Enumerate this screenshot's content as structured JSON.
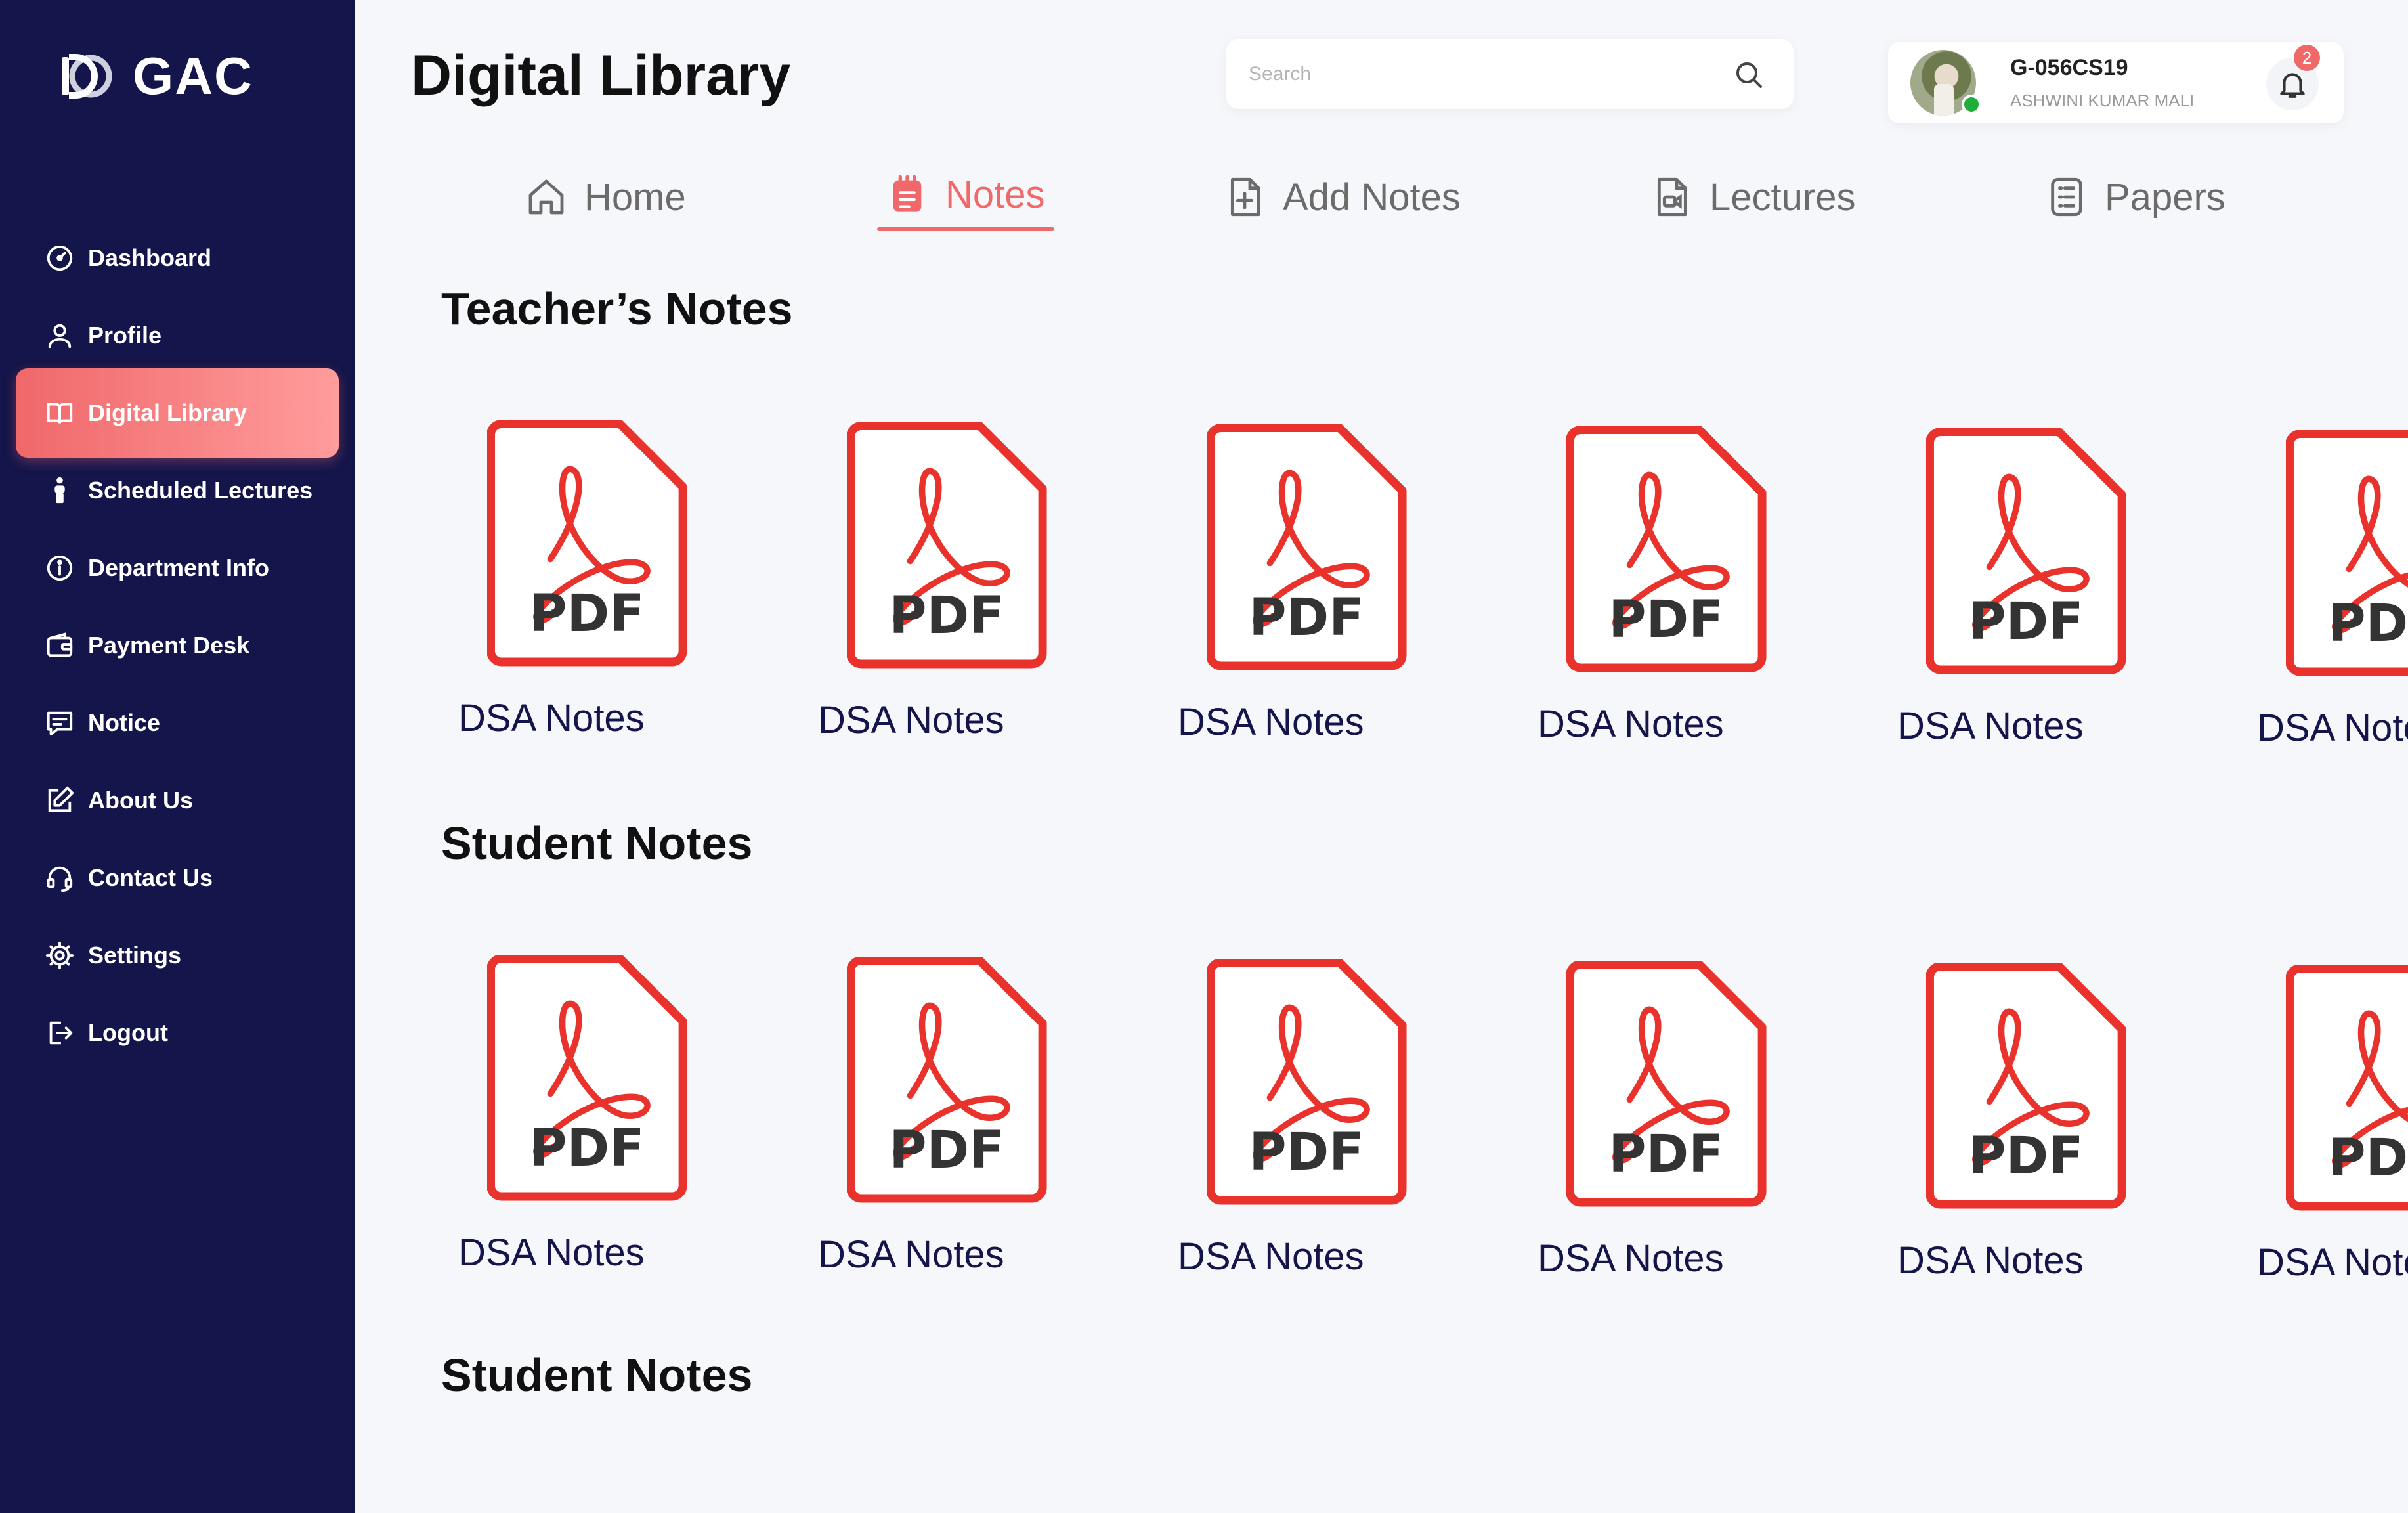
{
  "brand": {
    "name": "GAC"
  },
  "sidebar": {
    "items": [
      {
        "label": "Dashboard",
        "icon": "gauge-icon",
        "active": false
      },
      {
        "label": "Profile",
        "icon": "user-icon",
        "active": false
      },
      {
        "label": "Digital Library",
        "icon": "book-icon",
        "active": true
      },
      {
        "label": "Scheduled Lectures",
        "icon": "lecturer-icon",
        "active": false
      },
      {
        "label": "Department Info",
        "icon": "info-icon",
        "active": false
      },
      {
        "label": "Payment Desk",
        "icon": "wallet-icon",
        "active": false
      },
      {
        "label": "Notice",
        "icon": "message-icon",
        "active": false
      },
      {
        "label": "About Us",
        "icon": "edit-icon",
        "active": false
      },
      {
        "label": "Contact Us",
        "icon": "headset-icon",
        "active": false
      },
      {
        "label": "Settings",
        "icon": "gear-icon",
        "active": false
      },
      {
        "label": "Logout",
        "icon": "logout-icon",
        "active": false
      }
    ]
  },
  "header": {
    "title": "Digital Library",
    "search": {
      "placeholder": "Search",
      "value": ""
    },
    "user": {
      "id": "G-056CS19",
      "name": "ASHWINI KUMAR MALI",
      "notifications": "2"
    }
  },
  "tabs": [
    {
      "label": "Home",
      "icon": "home-icon",
      "active": false
    },
    {
      "label": "Notes",
      "icon": "notepad-icon",
      "active": true
    },
    {
      "label": "Add Notes",
      "icon": "file-plus-icon",
      "active": false
    },
    {
      "label": "Lectures",
      "icon": "file-video-icon",
      "active": false
    },
    {
      "label": "Papers",
      "icon": "list-file-icon",
      "active": false
    }
  ],
  "sections": [
    {
      "title": "Teacher’s Notes",
      "files": [
        {
          "name": "DSA Notes",
          "type": "PDF"
        },
        {
          "name": "DSA Notes",
          "type": "PDF"
        },
        {
          "name": "DSA Notes",
          "type": "PDF"
        },
        {
          "name": "DSA Notes",
          "type": "PDF"
        },
        {
          "name": "DSA Notes",
          "type": "PDF"
        },
        {
          "name": "DSA Notes",
          "type": "PDF"
        }
      ]
    },
    {
      "title": "Student Notes",
      "files": [
        {
          "name": "DSA Notes",
          "type": "PDF"
        },
        {
          "name": "DSA Notes",
          "type": "PDF"
        },
        {
          "name": "DSA Notes",
          "type": "PDF"
        },
        {
          "name": "DSA Notes",
          "type": "PDF"
        },
        {
          "name": "DSA Notes",
          "type": "PDF"
        },
        {
          "name": "DSA Notes",
          "type": "PDF"
        }
      ]
    },
    {
      "title": "Student Notes",
      "files": []
    }
  ],
  "colors": {
    "sidebar": "#14154a",
    "accent": "#f0686a",
    "pdf_red": "#e8322b",
    "background": "#f6f7fb"
  }
}
